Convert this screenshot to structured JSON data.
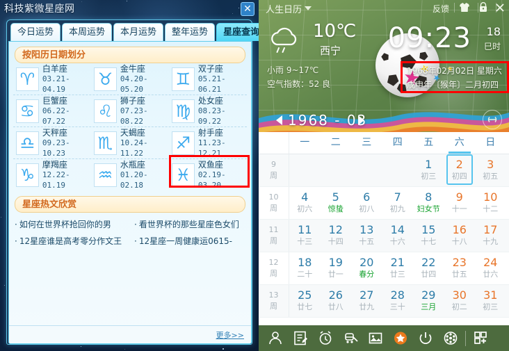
{
  "left": {
    "site_title": "科技紫微星座网",
    "close_label": "✕",
    "tabs": [
      {
        "label": "今日运势",
        "active": false
      },
      {
        "label": "本周运势",
        "active": false
      },
      {
        "label": "本月运势",
        "active": false
      },
      {
        "label": "整年运势",
        "active": false
      },
      {
        "label": "星座查询",
        "active": true
      }
    ],
    "section_solar": "按阳历日期划分",
    "zodiacs": [
      {
        "glyph": "♈",
        "name": "白羊座",
        "dates": "03.21-04.19",
        "highlight": false
      },
      {
        "glyph": "♉",
        "name": "金牛座",
        "dates": "04.20-05.20",
        "highlight": false
      },
      {
        "glyph": "♊",
        "name": "双子座",
        "dates": "05.21-06.21",
        "highlight": false
      },
      {
        "glyph": "♋",
        "name": "巨蟹座",
        "dates": "06.22-07.22",
        "highlight": false
      },
      {
        "glyph": "♌",
        "name": "狮子座",
        "dates": "07.23-08.22",
        "highlight": false
      },
      {
        "glyph": "♍",
        "name": "处女座",
        "dates": "08.23-09.22",
        "highlight": false
      },
      {
        "glyph": "♎",
        "name": "天秤座",
        "dates": "09.23-10.23",
        "highlight": false
      },
      {
        "glyph": "♏",
        "name": "天蝎座",
        "dates": "10.24-11.22",
        "highlight": false
      },
      {
        "glyph": "♐",
        "name": "射手座",
        "dates": "11.23-12.21",
        "highlight": false
      },
      {
        "glyph": "♑",
        "name": "摩羯座",
        "dates": "12.22-01.19",
        "highlight": false
      },
      {
        "glyph": "♒",
        "name": "水瓶座",
        "dates": "01.20-02.18",
        "highlight": false
      },
      {
        "glyph": "♓",
        "name": "双鱼座",
        "dates": "02.19-03.20",
        "highlight": true
      }
    ],
    "section_articles": "星座热文欣赏",
    "articles": [
      "如何在世界杯抢回你的男",
      "看世界杯的那些星座色女们",
      "12星座谁是高考零分作文王",
      "12星座一周健康运0615-"
    ],
    "more_label": "更多>>"
  },
  "right": {
    "app_title": "人生日历",
    "feedback_label": "反馈",
    "header_icons": [
      "shirt-icon",
      "lock-icon",
      "close-icon"
    ],
    "weather": {
      "temp": "10℃",
      "city": "西宁",
      "condition_range": "小雨 9~17℃",
      "air_index": "空气指数：52 良"
    },
    "clock": {
      "time": "09:23",
      "lunar_hour_num": "18",
      "lunar_hour": "巳时"
    },
    "date_box": {
      "line1": "1968年02月02日  星期六",
      "line2": "戊申年〔猴年〕二月初四"
    },
    "month_nav": {
      "prev": "◀",
      "next": "▶",
      "label": "1968 - 03",
      "refresh": "refresh-icon"
    },
    "weekdays": [
      "一",
      "二",
      "三",
      "四",
      "五",
      "六",
      "日"
    ],
    "today_col_index": 5,
    "weeks": [
      {
        "num": "9",
        "unit": "周",
        "days": [
          {
            "n": "",
            "sub": ""
          },
          {
            "n": "",
            "sub": ""
          },
          {
            "n": "",
            "sub": ""
          },
          {
            "n": "",
            "sub": ""
          },
          {
            "n": "",
            "sub": ""
          },
          {
            "n": "1",
            "sub": "初三",
            "weekend": false
          },
          {
            "n": "2",
            "sub": "初四",
            "weekend": true,
            "selected": true
          },
          {
            "n": "3",
            "sub": "初五",
            "weekend": true
          }
        ]
      },
      {
        "num": "10",
        "unit": "周",
        "days": [
          {
            "n": "4",
            "sub": "初六"
          },
          {
            "n": "5",
            "sub": "惊蛰",
            "fest": true
          },
          {
            "n": "6",
            "sub": "初八"
          },
          {
            "n": "7",
            "sub": "初九"
          },
          {
            "n": "8",
            "sub": "妇女节",
            "fest": true
          },
          {
            "n": "9",
            "sub": "十一",
            "weekend": true
          },
          {
            "n": "10",
            "sub": "十二",
            "weekend": true
          }
        ]
      },
      {
        "num": "11",
        "unit": "周",
        "days": [
          {
            "n": "11",
            "sub": "十三"
          },
          {
            "n": "12",
            "sub": "十四"
          },
          {
            "n": "13",
            "sub": "十五"
          },
          {
            "n": "14",
            "sub": "十六"
          },
          {
            "n": "15",
            "sub": "十七"
          },
          {
            "n": "16",
            "sub": "十八",
            "weekend": true
          },
          {
            "n": "17",
            "sub": "十九",
            "weekend": true
          }
        ]
      },
      {
        "num": "12",
        "unit": "周",
        "days": [
          {
            "n": "18",
            "sub": "二十"
          },
          {
            "n": "19",
            "sub": "廿一"
          },
          {
            "n": "20",
            "sub": "春分",
            "fest": true
          },
          {
            "n": "21",
            "sub": "廿三"
          },
          {
            "n": "22",
            "sub": "廿四"
          },
          {
            "n": "23",
            "sub": "廿五",
            "weekend": true
          },
          {
            "n": "24",
            "sub": "廿六",
            "weekend": true
          }
        ]
      },
      {
        "num": "13",
        "unit": "周",
        "days": [
          {
            "n": "25",
            "sub": "廿七"
          },
          {
            "n": "26",
            "sub": "廿八"
          },
          {
            "n": "27",
            "sub": "廿九"
          },
          {
            "n": "28",
            "sub": "三十"
          },
          {
            "n": "29",
            "sub": "三月",
            "fest": true
          },
          {
            "n": "30",
            "sub": "初二",
            "weekend": true
          },
          {
            "n": "31",
            "sub": "初三",
            "weekend": true
          }
        ]
      }
    ],
    "toolbar_icons": [
      "contacts-icon",
      "note-icon",
      "alarm-icon",
      "train-icon",
      "image-icon",
      "star-icon",
      "power-icon",
      "film-icon",
      "apps-add-icon"
    ],
    "colors": {
      "accent": "#56c4ee",
      "weekend": "#e8752a",
      "festival": "#19a331",
      "toolbar_bg": "#4d6b3e",
      "highlight_box": "#ff0000"
    }
  }
}
